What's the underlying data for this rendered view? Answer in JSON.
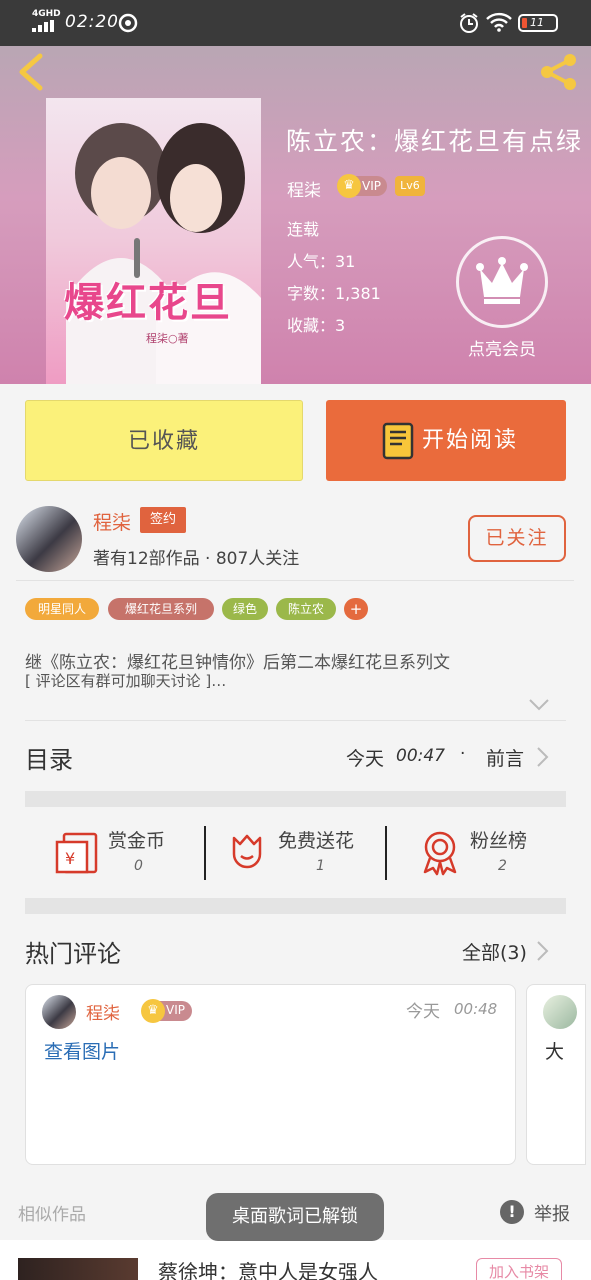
{
  "status_bar": {
    "network": "4GHD",
    "time": "02:20",
    "battery": "11"
  },
  "book": {
    "title": "陈立农：爆红花旦有点绿",
    "author": "程柒",
    "vip_label": "VIP",
    "level": "Lv6",
    "status": "连载",
    "popularity": "人气：31",
    "word_count": "字数：1,381",
    "favorites": "收藏：3",
    "cover_title": "爆红花旦",
    "cover_author": "程柒○著"
  },
  "member": {
    "label": "点亮会员"
  },
  "actions": {
    "collected_label": "已收藏",
    "read_label": "开始阅读"
  },
  "author_row": {
    "name": "程柒",
    "badge": "签约",
    "stats": "著有12部作品 · 807人关注",
    "follow_label": "已关注"
  },
  "tags": [
    "明星同人",
    "爆红花旦系列",
    "绿色",
    "陈立农",
    "+"
  ],
  "description": {
    "line1": "继《陈立农：爆红花旦钟情你》后第二本爆红花旦系列文",
    "line2": "[ 评论区有群可加聊天讨论 ]…"
  },
  "catalog": {
    "title": "目录",
    "date": "今天",
    "time": "00:47",
    "separator": "·",
    "latest": "前言"
  },
  "rewards": [
    {
      "label": "赏金币",
      "value": "0",
      "icon": "red-envelope-icon"
    },
    {
      "label": "免费送花",
      "value": "1",
      "icon": "flower-icon"
    },
    {
      "label": "粉丝榜",
      "value": "2",
      "icon": "medal-icon"
    }
  ],
  "comments": {
    "title": "热门评论",
    "all_label": "全部(3)",
    "first": {
      "user": "程柒",
      "vip": "VIP",
      "date": "今天",
      "time": "00:48",
      "content": "查看图片"
    },
    "second_preview": "大"
  },
  "footer": {
    "similar_label": "相似作品",
    "report_label": "举报",
    "toast": "桌面歌词已解锁",
    "similar_title": "蔡徐坤：意中人是女强人",
    "add_shelf": "加入书架"
  },
  "colors": {
    "accent": "#e0633e",
    "read_button": "#ea6b3c",
    "collected_button": "#fbf17a",
    "header_pink": "#cf82ad"
  }
}
